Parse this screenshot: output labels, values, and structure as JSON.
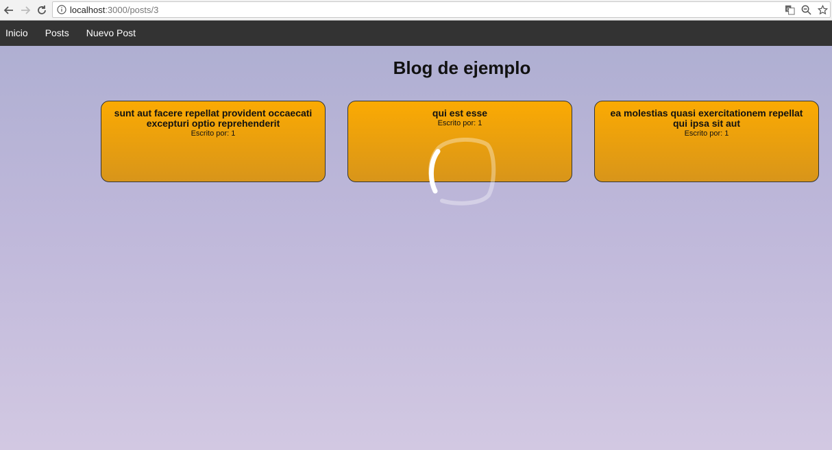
{
  "browser": {
    "url_host": "localhost",
    "url_rest": ":3000/posts/3",
    "icons": [
      "back-icon",
      "forward-icon",
      "reload-icon",
      "info-icon",
      "translate-icon",
      "zoom-out-icon",
      "star-icon"
    ]
  },
  "nav": {
    "items": [
      {
        "label": "Inicio"
      },
      {
        "label": "Posts"
      },
      {
        "label": "Nuevo Post"
      }
    ]
  },
  "page": {
    "title": "Blog de ejemplo"
  },
  "posts": [
    {
      "title": "sunt aut facere repellat provident occaecati excepturi optio reprehenderit",
      "author": "Escrito por: 1"
    },
    {
      "title": "qui est esse",
      "author": "Escrito por: 1"
    },
    {
      "title": "ea molestias quasi exercitationem repellat qui ipsa sit aut",
      "author": "Escrito por: 1"
    }
  ],
  "colors": {
    "nav_bg": "#333333",
    "card_top": "#fbaa02",
    "card_bottom": "#d8951a",
    "bg_top": "#afafd2",
    "bg_bottom": "#d2c8e2"
  }
}
